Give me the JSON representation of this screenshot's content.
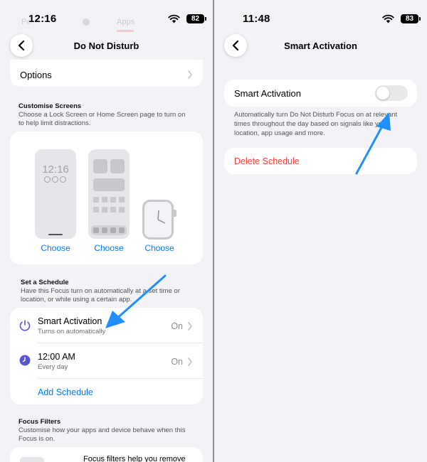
{
  "left": {
    "status": {
      "time": "12:16",
      "battery": "82"
    },
    "ghost": {
      "tab_left": "Pe",
      "tab_apps": "Apps"
    },
    "title": "Do Not Disturb",
    "options_label": "Options",
    "customise": {
      "heading": "Customise Screens",
      "description": "Choose a Lock Screen or Home Screen page to turn on to help limit distractions.",
      "lock_time": "12:16",
      "choose_labels": [
        "Choose",
        "Choose",
        "Choose"
      ]
    },
    "schedule": {
      "heading": "Set a Schedule",
      "description": "Have this Focus turn on automatically at a set time or location, or while using a certain app.",
      "smart_title": "Smart Activation",
      "smart_sub": "Turns on automatically",
      "smart_value": "On",
      "time_title": "12:00 AM",
      "time_sub": "Every day",
      "time_value": "On",
      "add_label": "Add Schedule"
    },
    "filters": {
      "heading": "Focus Filters",
      "description": "Customise how your apps and device behave when this Focus is on.",
      "card_text": "Focus filters help you remove"
    }
  },
  "right": {
    "status": {
      "time": "11:48",
      "battery": "83"
    },
    "title": "Smart Activation",
    "toggle_label": "Smart Activation",
    "toggle_on": false,
    "description": "Automatically turn Do Not Disturb Focus on at relevant times throughout the day based on signals like your location, app usage and more.",
    "delete_label": "Delete Schedule"
  },
  "colors": {
    "accent": "#007aff",
    "destructive": "#ff3b30",
    "annotation_arrow": "#1e90ff",
    "schedule_icon": "#5856d6",
    "background": "#f2f2f7"
  },
  "icons": {
    "back": "chevron-left-icon",
    "disclosure": "chevron-right-icon",
    "smart": "power-icon",
    "clock": "clock-icon",
    "wifi": "wifi-icon",
    "battery": "battery-icon"
  }
}
